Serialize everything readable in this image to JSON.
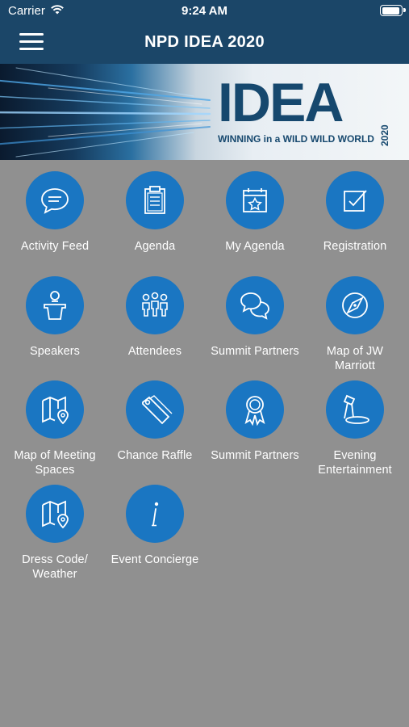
{
  "status_bar": {
    "carrier": "Carrier",
    "time": "9:24 AM"
  },
  "nav": {
    "title": "NPD IDEA 2020"
  },
  "banner": {
    "logo": "IDEA",
    "year": "2020",
    "tagline": "WINNING in a WILD WILD WORLD"
  },
  "tiles": [
    {
      "label": "Activity Feed",
      "icon": "chat-bubble-icon"
    },
    {
      "label": "Agenda",
      "icon": "clipboard-icon"
    },
    {
      "label": "My Agenda",
      "icon": "calendar-star-icon"
    },
    {
      "label": "Registration",
      "icon": "checkbox-icon"
    },
    {
      "label": "Speakers",
      "icon": "podium-speaker-icon"
    },
    {
      "label": "Attendees",
      "icon": "people-icon"
    },
    {
      "label": "Summit Partners",
      "icon": "chat-bubbles-icon"
    },
    {
      "label": "Map of JW Marriott",
      "icon": "compass-icon"
    },
    {
      "label": "Map of Meeting Spaces",
      "icon": "map-pin-icon"
    },
    {
      "label": "Chance Raffle",
      "icon": "ticket-tag-icon"
    },
    {
      "label": "Summit Partners",
      "icon": "ribbon-award-icon"
    },
    {
      "label": "Evening Entertainment",
      "icon": "spotlight-icon"
    },
    {
      "label": "Dress Code/ Weather",
      "icon": "map-pin-icon"
    },
    {
      "label": "Event Concierge",
      "icon": "info-icon"
    }
  ],
  "colors": {
    "nav_bg": "#1b4668",
    "tile_bg": "#1a76c2",
    "page_bg": "#909090"
  }
}
